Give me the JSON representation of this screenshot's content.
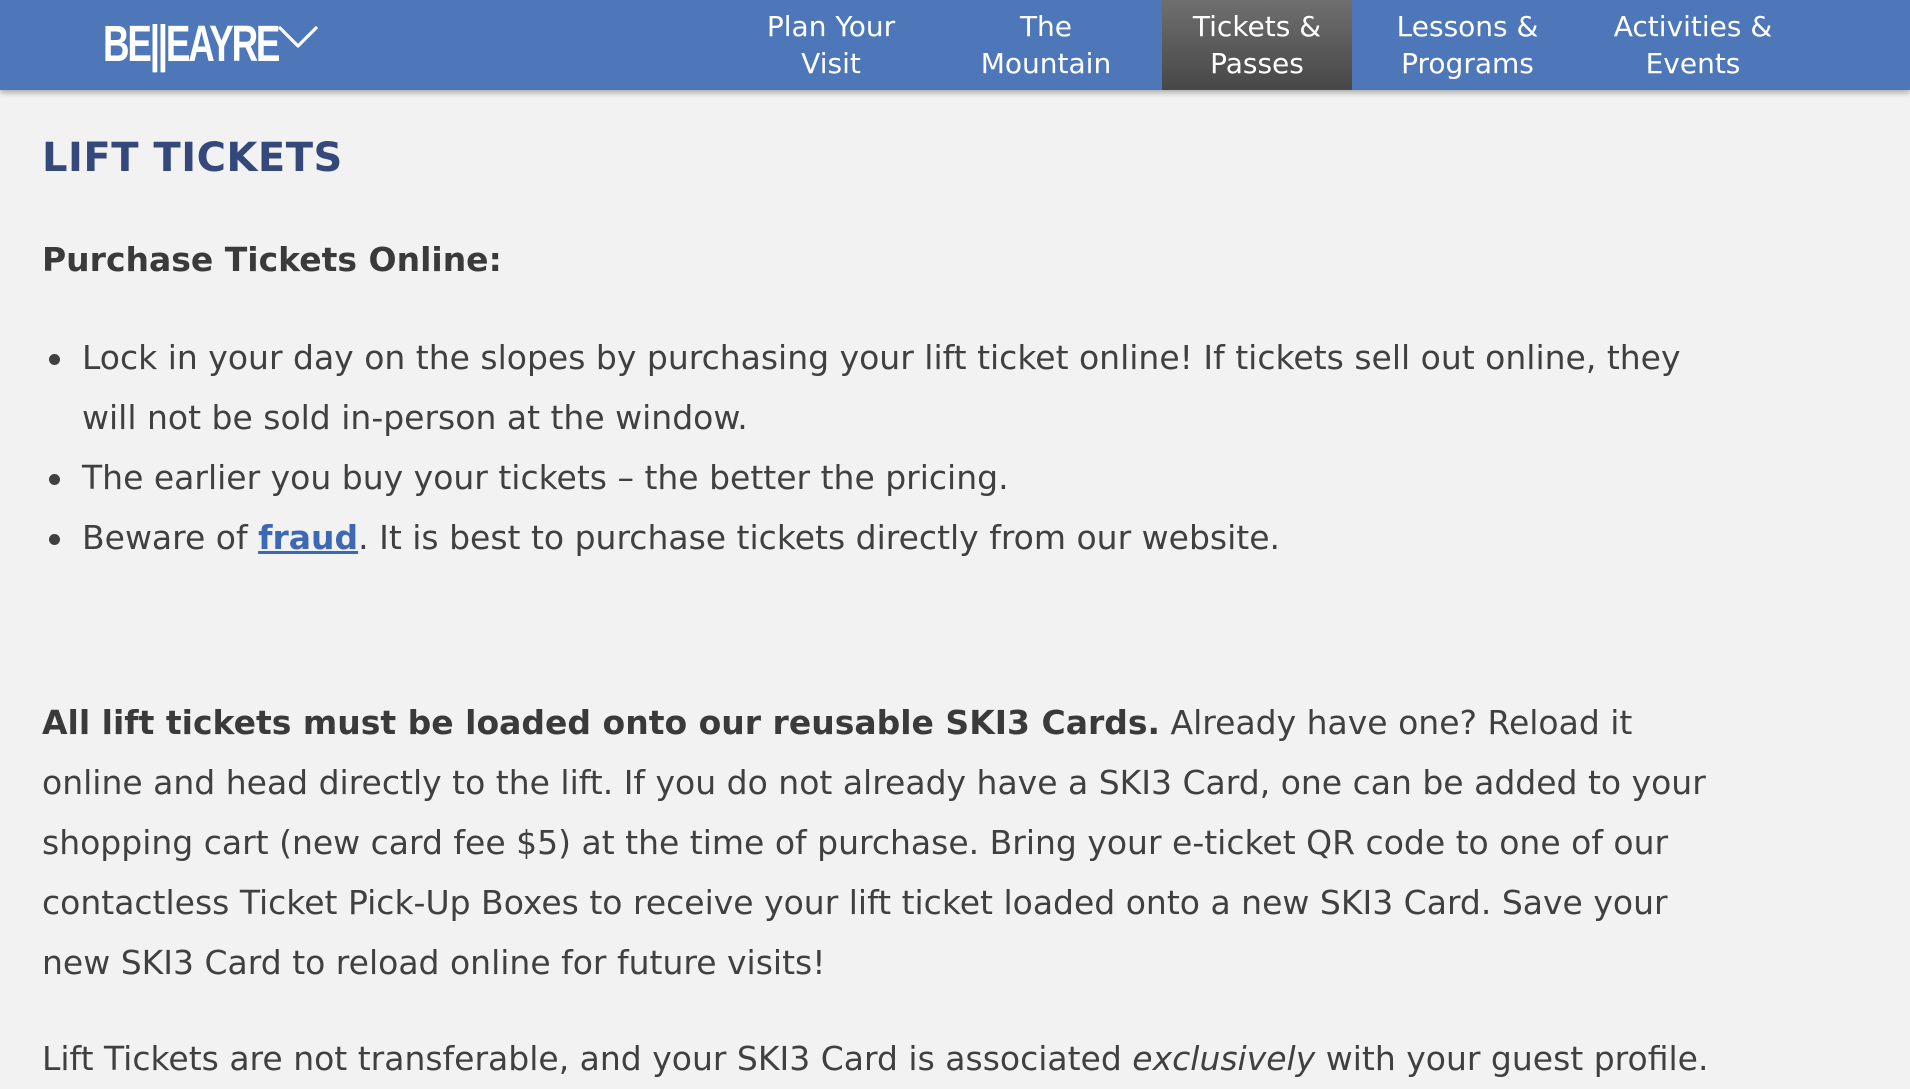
{
  "header": {
    "logo_text": "BE||EAYRE",
    "nav": [
      {
        "line1": "Plan Your",
        "line2": "Visit"
      },
      {
        "line1": "The",
        "line2": "Mountain"
      },
      {
        "line1": "Tickets &",
        "line2": "Passes",
        "active": true
      },
      {
        "line1": "Lessons &",
        "line2": "Programs"
      },
      {
        "line1": "Activities &",
        "line2": "Events"
      }
    ]
  },
  "main": {
    "title": "LIFT TICKETS",
    "subheading": "Purchase Tickets Online:",
    "bullets": [
      {
        "text": "Lock in your day on the slopes by purchasing your lift ticket online! If tickets sell out online, they will not be sold in-person at the window."
      },
      {
        "text": "The earlier you buy your tickets – the better the pricing."
      },
      {
        "before": "Beware of ",
        "link": "fraud",
        "after": ". It is best to purchase tickets directly from our website."
      }
    ],
    "para1_bold": "All lift tickets must be loaded onto our reusable SKI3 Cards.",
    "para1_rest": " Already have one? Reload it online and head directly to the lift. If you do not already have a SKI3 Card, one can be added to your shopping cart (new card fee $5) at the time of purchase. Bring your e-ticket QR code to one of our contactless Ticket Pick-Up Boxes to receive your lift ticket loaded onto a new SKI3 Card. Save your new SKI3 Card to reload online for future visits!",
    "para2_before": "Lift Tickets are not transferable, and your SKI3 Card is associated ",
    "para2_em": "exclusively",
    "para2_after": " with your guest profile."
  },
  "colors": {
    "header_bg": "#4e77ba",
    "active_nav_bg": "#555555",
    "title": "#34497a",
    "link": "#3d68b3",
    "page_bg": "#f2f2f2"
  },
  "icons": {
    "logo_dropdown": "chevron-down-icon"
  }
}
